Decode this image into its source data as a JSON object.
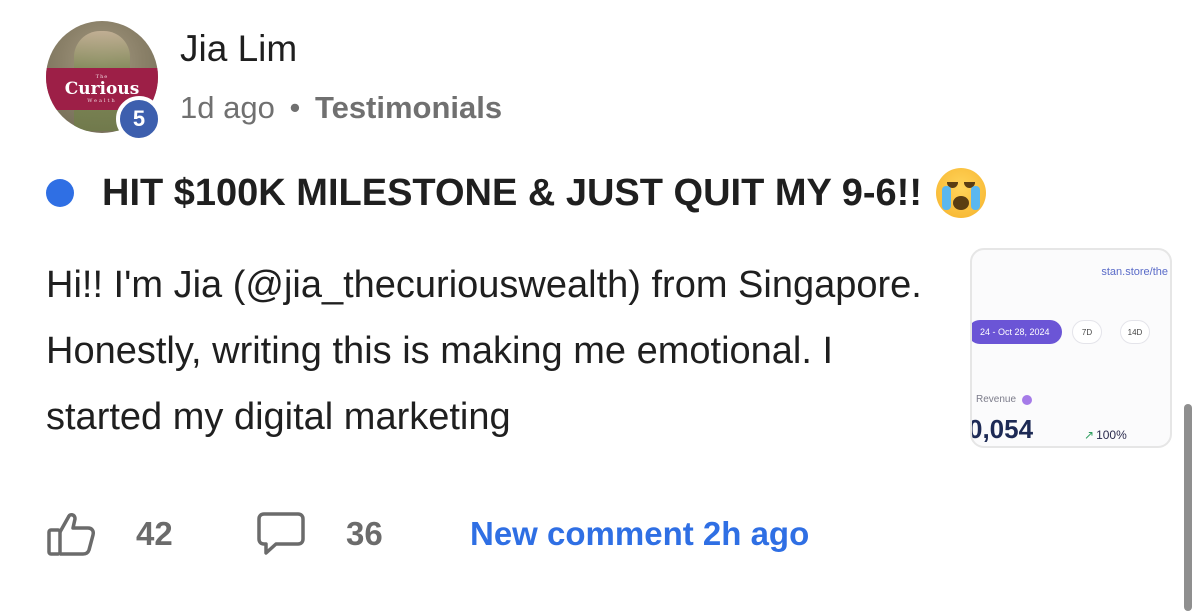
{
  "post": {
    "author": {
      "name": "Jia Lim",
      "level": "5",
      "avatar_brand": {
        "top": "The",
        "main": "Curious",
        "sub": "Wealth"
      }
    },
    "time_ago": "1d ago",
    "separator": "•",
    "category": "Testimonials",
    "title": "HIT $100K MILESTONE & JUST QUIT MY 9-6!!",
    "title_emoji": "loudly-crying-face",
    "body": "Hi!! I'm Jia (@jia_thecuriouswealth) from Singapore. Honestly, writing this is making me emotional. I started my digital marketing",
    "thumbnail": {
      "store_url": "stan.store/the",
      "date_range": "24 - Oct 28, 2024",
      "range_options": [
        "7D",
        "14D"
      ],
      "revenue_label": "Revenue",
      "revenue_value": "0,054",
      "revenue_change": "100%"
    },
    "likes": "42",
    "comments": "36",
    "new_comment": "New comment 2h ago"
  },
  "colors": {
    "accent": "#2f6fe4",
    "level_badge": "#3d5fae",
    "brand": "#9d1f47",
    "muted": "#707070"
  }
}
